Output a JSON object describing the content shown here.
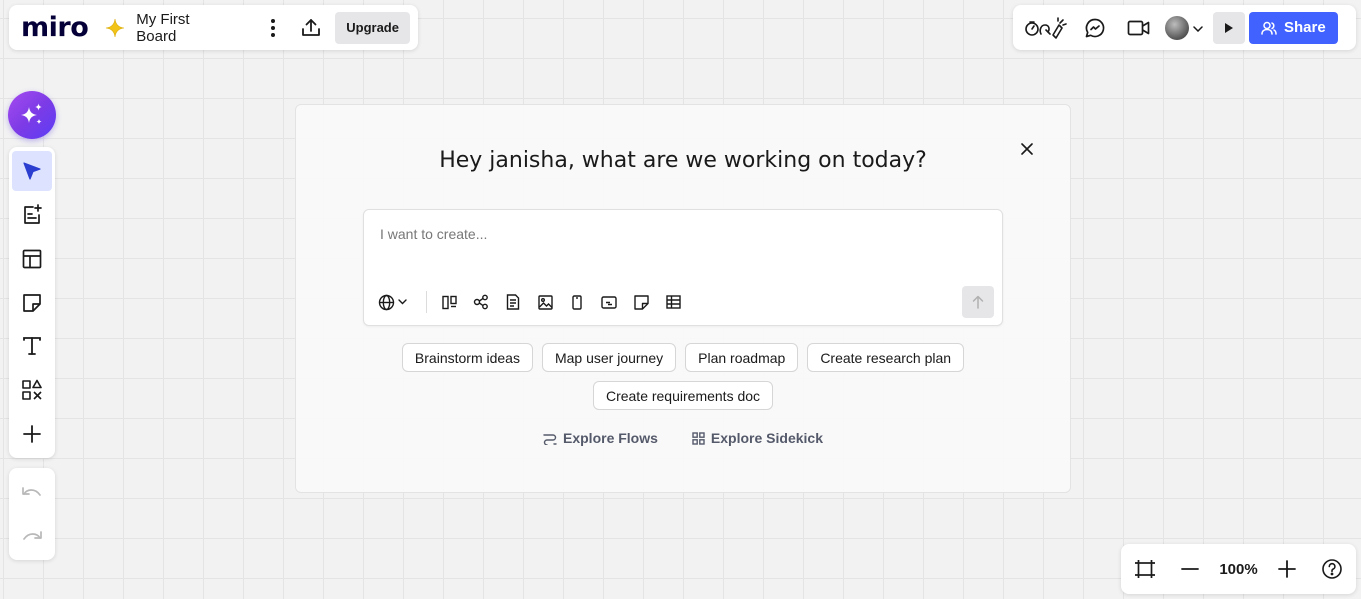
{
  "app": {
    "logo": "miro",
    "board_title": "My First Board",
    "upgrade_label": "Upgrade"
  },
  "header_right": {
    "share_label": "Share"
  },
  "dialog": {
    "title": "Hey janisha, what are we working on today?",
    "prompt_placeholder": "I want to create...",
    "suggestions": [
      "Brainstorm ideas",
      "Map user journey",
      "Plan roadmap",
      "Create research plan",
      "Create requirements doc"
    ],
    "explore_flows": "Explore Flows",
    "explore_sidekick": "Explore Sidekick"
  },
  "zoom": {
    "value": "100%"
  },
  "colors": {
    "accent": "#4262ff",
    "ai_gradient_start": "#a64cf0",
    "ai_gradient_end": "#5b3df5",
    "star": "#f2c318"
  },
  "icons": {
    "left_toolbar": [
      "select-icon",
      "ai-doc-icon",
      "templates-icon",
      "sticky-note-icon",
      "text-icon",
      "shapes-icon",
      "add-icon"
    ],
    "prompt_tools": [
      "globe-icon",
      "kanban-icon",
      "diagram-icon",
      "document-icon",
      "image-icon",
      "mobile-icon",
      "prototype-icon",
      "sticky-note-icon",
      "table-icon"
    ]
  }
}
